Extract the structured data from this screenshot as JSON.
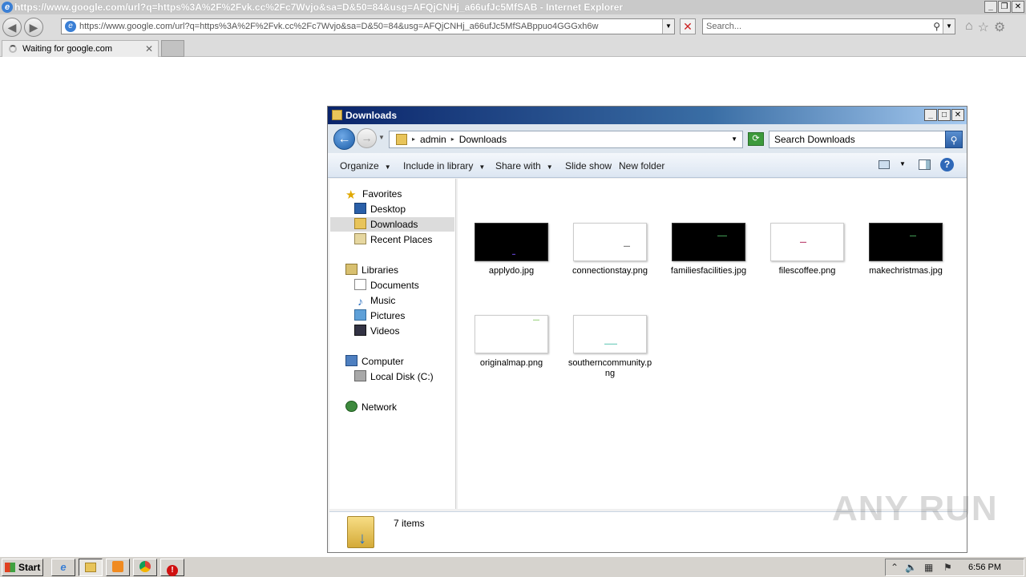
{
  "ie": {
    "title": "https://www.google.com/url?q=https%3A%2F%2Fvk.cc%2Fc7Wvjo&sa=D&50=84&usg=AFQjCNHj_a66ufJc5MfSAB - Internet Explorer",
    "address": "https://www.google.com/url?q=https%3A%2F%2Fvk.cc%2Fc7Wvjo&sa=D&50=84&usg=AFQjCNHj_a66ufJc5MfSABppuo4GGGxh6w",
    "search_placeholder": "Search...",
    "tab_label": "Waiting for google.com"
  },
  "explorer": {
    "title": "Downloads",
    "breadcrumb": [
      "admin",
      "Downloads"
    ],
    "search_placeholder": "Search Downloads",
    "toolbar": {
      "organize": "Organize",
      "include": "Include in library",
      "share": "Share with",
      "slideshow": "Slide show",
      "newfolder": "New folder"
    },
    "nav": {
      "favorites": "Favorites",
      "desktop": "Desktop",
      "downloads": "Downloads",
      "recent": "Recent Places",
      "libraries": "Libraries",
      "documents": "Documents",
      "music": "Music",
      "pictures": "Pictures",
      "videos": "Videos",
      "computer": "Computer",
      "localdisk": "Local Disk (C:)",
      "network": "Network"
    },
    "files": [
      {
        "name": "applydo.jpg",
        "thumb": "dark"
      },
      {
        "name": "connectionstay.png",
        "thumb": "light"
      },
      {
        "name": "familiesfacilities.jpg",
        "thumb": "dark"
      },
      {
        "name": "filescoffee.png",
        "thumb": "light"
      },
      {
        "name": "makechristmas.jpg",
        "thumb": "dark"
      },
      {
        "name": "originalmap.png",
        "thumb": "light"
      },
      {
        "name": "southerncommunity.png",
        "thumb": "light"
      }
    ],
    "item_count": "7 items"
  },
  "watermark": "ANY RUN",
  "taskbar": {
    "start": "Start",
    "clock": "6:56 PM"
  }
}
